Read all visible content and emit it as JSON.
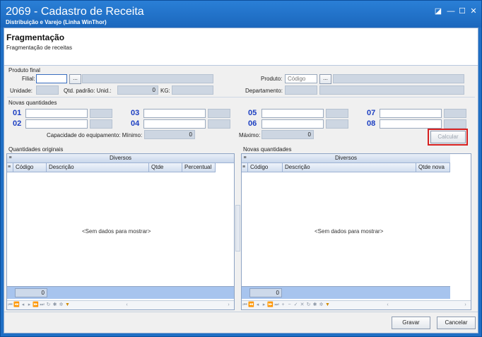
{
  "window": {
    "title": "2069 - Cadastro de Receita",
    "subtitle": "Distribuição e Varejo (Linha WinThor)",
    "controls": {
      "restore": "◪",
      "minimize": "—",
      "maximize": "☐",
      "close": "✕"
    }
  },
  "header": {
    "title": "Fragmentação",
    "subtitle": "Fragmentação de receitas"
  },
  "produto_final": {
    "group_label": "Produto final",
    "filial_label": "Filial:",
    "filial_value": "",
    "dots_label": "...",
    "unidade_label": "Unidade:",
    "qtd_padrao_label": "Qtd. padrão: Unid.:",
    "qtd_padrao_value": "0",
    "kg_label": "KG:",
    "produto_label": "Produto:",
    "produto_placeholder": "Código",
    "departamento_label": "Departamento:"
  },
  "novas_quantidades": {
    "group_label": "Novas quantidades",
    "slots": [
      "01",
      "02",
      "03",
      "04",
      "05",
      "06",
      "07",
      "08"
    ],
    "capacidade_label": "Capacidade do equipamento: Mínimo:",
    "minimo_value": "0",
    "maximo_label": "Máximo:",
    "maximo_value": "0",
    "calcular_label": "Calcular"
  },
  "grid_left": {
    "title": "Quantidades originais",
    "band": "Diversos",
    "columns": [
      "Código",
      "Descrição",
      "Qtde",
      "Percentual"
    ],
    "empty_text": "<Sem dados para mostrar>",
    "footer_value": "0"
  },
  "grid_right": {
    "title": "Novas quantidades",
    "band": "Diversos",
    "columns": [
      "Código",
      "Descrição",
      "Qtde nova"
    ],
    "empty_text": "<Sem dados para mostrar>",
    "footer_value": "0"
  },
  "buttons": {
    "gravar": "Gravar",
    "cancelar": "Cancelar"
  },
  "colors": {
    "titlebar": "#1b67bd",
    "slot_number": "#1c3fc2",
    "highlight": "#d62020"
  }
}
